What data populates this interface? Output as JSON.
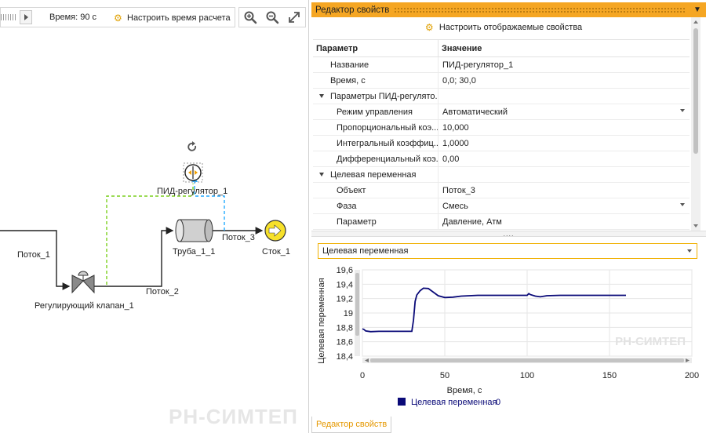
{
  "toolbar": {
    "time_label": "Время: 90 с",
    "configure_time_label": "Настроить время расчета"
  },
  "diagram": {
    "labels": {
      "flow1": "Поток_1",
      "flow2": "Поток_2",
      "flow3": "Поток_3",
      "pipe": "Труба_1_1",
      "sink": "Сток_1",
      "valve": "Регулирующий клапан_1",
      "pid": "ПИД-регулятор_1"
    },
    "watermark": "РН-СИМТЕП"
  },
  "panel": {
    "title": "Редактор свойств",
    "configure_props_label": "Настроить отображаемые свойства",
    "columns": {
      "param": "Параметр",
      "value": "Значение"
    },
    "rows": [
      {
        "key": "Название",
        "value": "ПИД-регулятор_1",
        "level": "ind1",
        "dropdown": false
      },
      {
        "key": "Время, с",
        "value": "0,0; 30,0",
        "level": "ind1",
        "dropdown": false
      },
      {
        "key": "Параметры ПИД-регулято...",
        "value": "",
        "level": "grp",
        "dropdown": false,
        "group": true
      },
      {
        "key": "Режим управления",
        "value": "Автоматический",
        "level": "ind2",
        "dropdown": true
      },
      {
        "key": "Пропорциональный коэ...",
        "value": "10,000",
        "level": "ind2",
        "dropdown": false
      },
      {
        "key": "Интегральный коэффиц...",
        "value": "1,0000",
        "level": "ind2",
        "dropdown": false
      },
      {
        "key": "Дифференциальный коэ...",
        "value": "0,00",
        "level": "ind2",
        "dropdown": false
      },
      {
        "key": "Целевая переменная",
        "value": "",
        "level": "grp",
        "dropdown": false,
        "group": true
      },
      {
        "key": "Объект",
        "value": "Поток_3",
        "level": "ind2",
        "dropdown": false
      },
      {
        "key": "Фаза",
        "value": "Смесь",
        "level": "ind2",
        "dropdown": true
      },
      {
        "key": "Параметр",
        "value": "Давление, Атм",
        "level": "ind2",
        "dropdown": false
      }
    ],
    "splitter_grip": "....",
    "variable_select": "Целевая переменная",
    "bottom_tab": "Редактор свойств"
  },
  "chart_data": {
    "type": "line",
    "title": "",
    "xlabel": "Время, с",
    "ylabel": "Целевая переменная",
    "xlim": [
      0,
      200
    ],
    "ylim": [
      18.4,
      19.6
    ],
    "xticks": [
      0,
      50,
      100,
      150,
      200
    ],
    "yticks": [
      18.4,
      18.6,
      18.8,
      19,
      19.2,
      19.4,
      19.6
    ],
    "ytick_labels": [
      "18,4",
      "18,6",
      "18,8",
      "19",
      "19,2",
      "19,4",
      "19,6"
    ],
    "grid": true,
    "legend": "bottom",
    "watermark": "РН-СИМТЕП",
    "series": [
      {
        "name": "Целевая переменная",
        "legend_value": "0",
        "color": "#0a0a78",
        "x": [
          0,
          1,
          2,
          5,
          10,
          20,
          30,
          31,
          32,
          33,
          35,
          37,
          40,
          43,
          46,
          50,
          55,
          60,
          70,
          80,
          90,
          98,
          100,
          101,
          102,
          105,
          108,
          112,
          120,
          130,
          140,
          150,
          160
        ],
        "y": [
          18.78,
          18.77,
          18.75,
          18.74,
          18.745,
          18.745,
          18.745,
          18.9,
          19.16,
          19.25,
          19.31,
          19.345,
          19.34,
          19.29,
          19.24,
          19.215,
          19.22,
          19.235,
          19.245,
          19.245,
          19.245,
          19.245,
          19.245,
          19.27,
          19.255,
          19.235,
          19.225,
          19.24,
          19.245,
          19.245,
          19.245,
          19.245,
          19.245
        ]
      }
    ]
  }
}
